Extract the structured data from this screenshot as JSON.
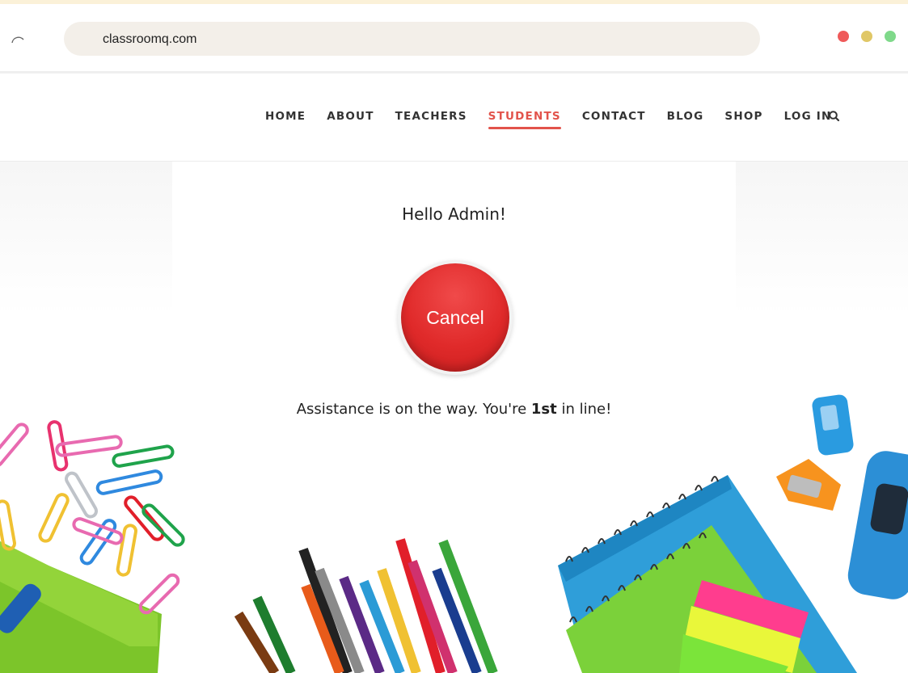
{
  "browser": {
    "url": "classroomq.com",
    "window_controls": [
      "close",
      "minimize",
      "maximize"
    ]
  },
  "nav": {
    "items": [
      {
        "label": "HOME",
        "active": false
      },
      {
        "label": "ABOUT",
        "active": false
      },
      {
        "label": "TEACHERS",
        "active": false
      },
      {
        "label": "STUDENTS",
        "active": true
      },
      {
        "label": "CONTACT",
        "active": false
      },
      {
        "label": "BLOG",
        "active": false
      },
      {
        "label": "SHOP",
        "active": false
      },
      {
        "label": "LOG IN",
        "active": false
      }
    ],
    "search_icon": "search-icon"
  },
  "main": {
    "greeting": "Hello Admin!",
    "cancel_label": "Cancel",
    "status_prefix": "Assistance is on the way. You're ",
    "status_rank": "1st",
    "status_suffix": " in line!"
  },
  "colors": {
    "accent": "#e2534b",
    "cancel_button": "#e02a2a"
  }
}
